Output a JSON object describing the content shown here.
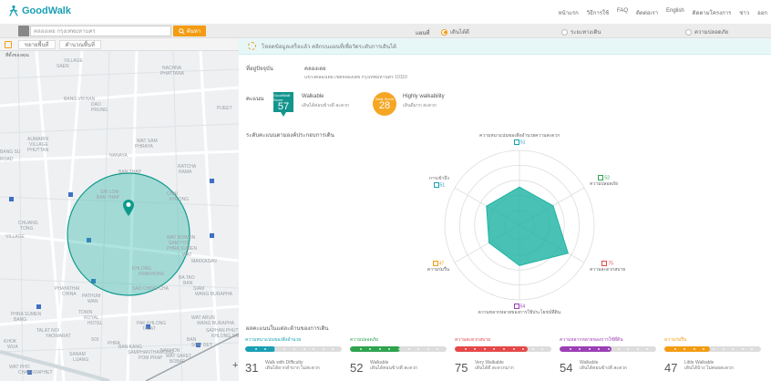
{
  "app": {
    "name": "GoodWalk"
  },
  "topnav": [
    "หน้าแรก",
    "วิธีการใช้",
    "FAQ",
    "ติดต่อเรา",
    "English",
    "ติดตามโครงการ",
    "ข่าว",
    "ออก"
  ],
  "search": {
    "value": "คลองเตย กรุงเทพมหานคร",
    "button": "ค้นหา"
  },
  "mode": {
    "label": "แผนที่",
    "options": [
      {
        "label": "เดินได้ดี",
        "selected": true
      },
      {
        "label": "ระยะทางเดิน",
        "selected": false
      },
      {
        "label": "ความปลอดภัย",
        "selected": false
      }
    ]
  },
  "maptools": [
    "ขยายพื้นที่",
    "คำนวณพื้นที่"
  ],
  "map": {
    "legend": "ที่ตั้งของคุณ",
    "labels": [
      "VILLAGE",
      "SAEN",
      "NACHNA",
      "PHATTANA",
      "BANG VIKHAN",
      "DAO",
      "PRUNG",
      "PUEET",
      "AUMARIN",
      "VILLAGE",
      "PHUTTAN",
      "WAT SAM",
      "PHRAYA",
      "NANAYA",
      "BANG SU",
      "ROAD",
      "RATCHA",
      "RAMA",
      "BAN THAP",
      "SRI LOM",
      "BAN THAP",
      "CHAI",
      "KHLONG",
      "CHUANG",
      "TONG",
      "VILLAGE",
      "WAT BOWON",
      "SAM YOT",
      "PHRA SUMEN",
      "WAT",
      "MAKKASAN",
      "KHLONG",
      "PRAKHONG",
      "BA TAO",
      "BAN",
      "SAO CHING CHA",
      "SIAM",
      "WANG BURAPHA",
      "PATHUM",
      "WAN",
      "PHRA SUMEN",
      "BANG",
      "PHAYATHAI",
      "CHINA",
      "TOWN",
      "ROYAL",
      "HOTEL",
      "KHOK",
      "WUA",
      "BAN KANG",
      "SAMPHANTHAWONG",
      "POM PRAP",
      "SOI",
      "PHRA",
      "NAKHON",
      "WAT SAKET",
      "BOBAE",
      "TALAT NOI",
      "YAOWARAT",
      "SANAM",
      "LUANG",
      "WAT PHO",
      "CHAKKRAPHET",
      "PAK KHLONG",
      "TALAT",
      "WAT ARUN",
      "WANG BURAPHA",
      "SAPHAN PHUT",
      "KHLONG SAN",
      "BAN",
      "SOM DET"
    ],
    "zoom_symbol": "+",
    "accent": "#1bb3a3"
  },
  "banner": "โหลดข้อมูลเสร็จแล้ว คลิกบนแผนที่เพื่อวัดระดับการเดินได้",
  "address": {
    "label": "ที่อยู่ปัจจุบัน",
    "value": "คลองเตย",
    "sub": "แขวงคลองเตย เขตคลองเตย กรุงเทพมหานคร 10110"
  },
  "score": {
    "label": "คะแนน",
    "goodwalk": {
      "tag": "GoodWalk Score",
      "value": "57",
      "title": "Walkable",
      "desc": "เดินได้ค่อนข้างดี สะดวก"
    },
    "walkscore": {
      "tag": "Walk Score",
      "value": "28",
      "title": "Highly walkability",
      "desc": "เดินดีมาก สะดวก"
    }
  },
  "radar": {
    "title": "ระดับคะแนนตามองค์ประกอบการเดิน",
    "colors": {
      "fill": "#1bb3a3",
      "grid": "#dddddd"
    },
    "axes": [
      {
        "name": "ความหนาแน่นของสิ่งอำนวยความสะดวก",
        "value": 51,
        "color": "#1a9fb4"
      },
      {
        "name": "ความปลอดภัย",
        "value": 52,
        "color": "#2ea44f"
      },
      {
        "name": "ความสะดวกสบาย",
        "value": 75,
        "color": "#e54848"
      },
      {
        "name": "ความหลากหลายของการใช้ประโยชน์ที่ดิน",
        "value": 54,
        "color": "#9b3fb5"
      },
      {
        "name": "ความร่มรื่น",
        "value": 47,
        "color": "#f39c12"
      },
      {
        "name": "การเข้าถึง",
        "value": 51,
        "color": "#1a9fb4"
      }
    ]
  },
  "categories_title": "ผลคะแนนในแต่ละด้านของการเดิน",
  "categories": [
    {
      "name": "ความหนาแน่นของสิ่งอำนวย",
      "score": "31",
      "level": "Walk with Difficulty",
      "desc": "เดินได้ยากลำบาก ไม่สะดวก",
      "color": "#1a9fb4",
      "fraction": 0.31
    },
    {
      "name": "ความปลอดภัย",
      "score": "52",
      "level": "Walkable",
      "desc": "เดินได้ค่อนข้างดี สะดวก",
      "color": "#2ea44f",
      "fraction": 0.52
    },
    {
      "name": "ความสะดวกสบาย",
      "score": "75",
      "level": "Very Walkable",
      "desc": "เดินได้ดี สะดวกมาก",
      "color": "#e54848",
      "fraction": 0.75
    },
    {
      "name": "ความหลากหลายของการใช้ที่ดิน",
      "score": "54",
      "level": "Walkable",
      "desc": "เดินได้ค่อนข้างดี สะดวก",
      "color": "#9b3fb5",
      "fraction": 0.54
    },
    {
      "name": "ความร่มรื่น",
      "score": "47",
      "level": "Little Walkable",
      "desc": "เดินได้บ้าง ไม่ค่อยสะดวก",
      "color": "#f39c12",
      "fraction": 0.47
    }
  ]
}
